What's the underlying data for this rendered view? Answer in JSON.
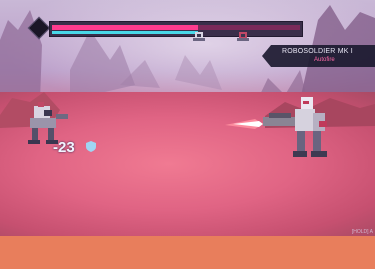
{
  "enemy": {
    "name": "ROBOSOLDIER MK I",
    "weapon": "Autofire",
    "hp_fraction": 0.59,
    "shield_fraction": 0.59
  },
  "combat": {
    "damage_text": "-23"
  },
  "hud": {
    "corner_text": "[HOLD] A"
  },
  "colors": {
    "hp": "#ff3b8e",
    "shield": "#49d8e8",
    "panel": "#1c1a30",
    "ground": "#e06484",
    "bottom_bar": "#e87e5c"
  },
  "icons": [
    "enemy-turn-icon",
    "shield-icon",
    "turn-gem-icon"
  ]
}
